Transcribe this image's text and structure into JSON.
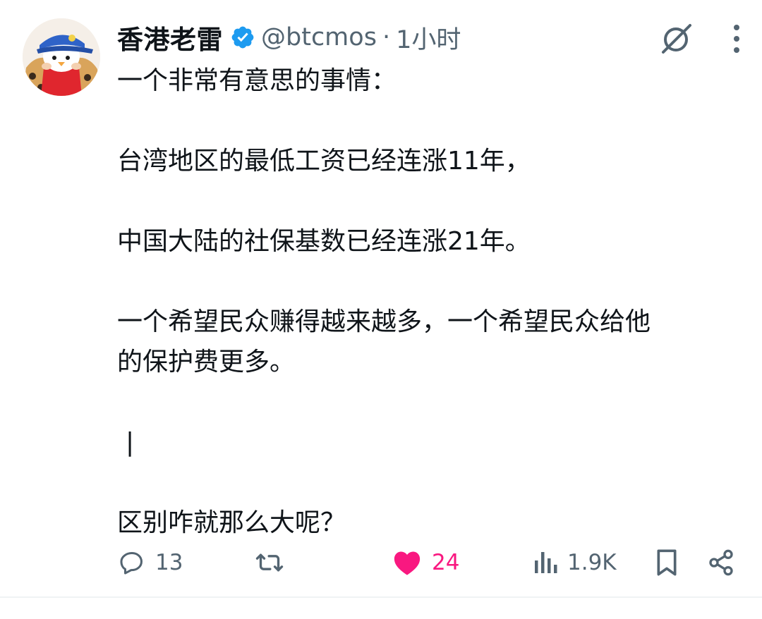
{
  "tweet": {
    "author": {
      "display_name": "香港老雷",
      "handle": "@btcmos",
      "separator": "·",
      "time": "1小时",
      "avatar_icon": "penguin-avatar-icon",
      "verified_icon": "verified-badge-icon"
    },
    "header_icons": [
      "grok-icon",
      "more-icon"
    ],
    "body": {
      "line1": "一个非常有意思的事情：",
      "line2": "台湾地区的最低工资已经连涨11年，",
      "line3": "中国大陆的社保基数已经连涨21年。",
      "line4": "一个希望民众赚得越来越多，一个希望民众给他",
      "line5": "的保护费更多。",
      "line6": "|",
      "line7": "区别咋就那么大呢？"
    },
    "actions": {
      "reply": {
        "icon": "reply-icon",
        "count": "13"
      },
      "retweet": {
        "icon": "retweet-icon"
      },
      "like": {
        "icon": "heart-icon",
        "count": "24",
        "liked": true
      },
      "views": {
        "icon": "views-icon",
        "count": "1.9K"
      },
      "bookmark": {
        "icon": "bookmark-icon"
      },
      "share": {
        "icon": "share-icon"
      }
    },
    "colors": {
      "verified": "#1d9bf0",
      "like": "#f91880",
      "muted": "#536471",
      "text": "#0f1419"
    }
  }
}
